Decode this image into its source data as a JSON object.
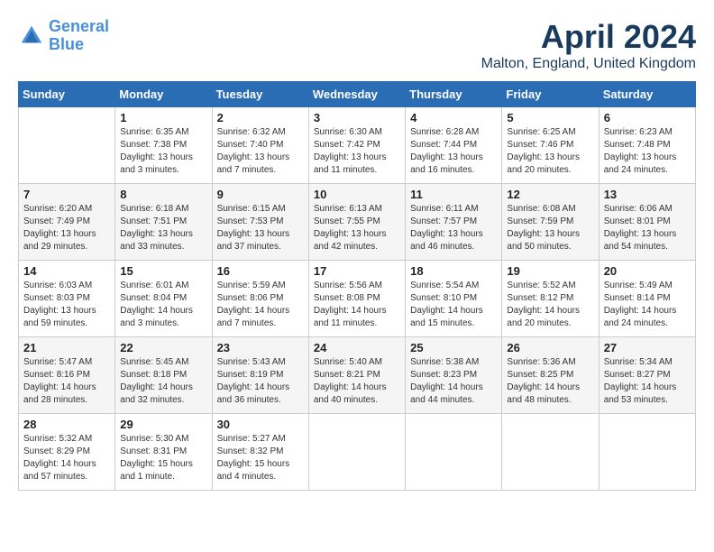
{
  "header": {
    "logo_line1": "General",
    "logo_line2": "Blue",
    "month": "April 2024",
    "location": "Malton, England, United Kingdom"
  },
  "weekdays": [
    "Sunday",
    "Monday",
    "Tuesday",
    "Wednesday",
    "Thursday",
    "Friday",
    "Saturday"
  ],
  "weeks": [
    [
      {
        "day": "",
        "sunrise": "",
        "sunset": "",
        "daylight": ""
      },
      {
        "day": "1",
        "sunrise": "Sunrise: 6:35 AM",
        "sunset": "Sunset: 7:38 PM",
        "daylight": "Daylight: 13 hours and 3 minutes."
      },
      {
        "day": "2",
        "sunrise": "Sunrise: 6:32 AM",
        "sunset": "Sunset: 7:40 PM",
        "daylight": "Daylight: 13 hours and 7 minutes."
      },
      {
        "day": "3",
        "sunrise": "Sunrise: 6:30 AM",
        "sunset": "Sunset: 7:42 PM",
        "daylight": "Daylight: 13 hours and 11 minutes."
      },
      {
        "day": "4",
        "sunrise": "Sunrise: 6:28 AM",
        "sunset": "Sunset: 7:44 PM",
        "daylight": "Daylight: 13 hours and 16 minutes."
      },
      {
        "day": "5",
        "sunrise": "Sunrise: 6:25 AM",
        "sunset": "Sunset: 7:46 PM",
        "daylight": "Daylight: 13 hours and 20 minutes."
      },
      {
        "day": "6",
        "sunrise": "Sunrise: 6:23 AM",
        "sunset": "Sunset: 7:48 PM",
        "daylight": "Daylight: 13 hours and 24 minutes."
      }
    ],
    [
      {
        "day": "7",
        "sunrise": "Sunrise: 6:20 AM",
        "sunset": "Sunset: 7:49 PM",
        "daylight": "Daylight: 13 hours and 29 minutes."
      },
      {
        "day": "8",
        "sunrise": "Sunrise: 6:18 AM",
        "sunset": "Sunset: 7:51 PM",
        "daylight": "Daylight: 13 hours and 33 minutes."
      },
      {
        "day": "9",
        "sunrise": "Sunrise: 6:15 AM",
        "sunset": "Sunset: 7:53 PM",
        "daylight": "Daylight: 13 hours and 37 minutes."
      },
      {
        "day": "10",
        "sunrise": "Sunrise: 6:13 AM",
        "sunset": "Sunset: 7:55 PM",
        "daylight": "Daylight: 13 hours and 42 minutes."
      },
      {
        "day": "11",
        "sunrise": "Sunrise: 6:11 AM",
        "sunset": "Sunset: 7:57 PM",
        "daylight": "Daylight: 13 hours and 46 minutes."
      },
      {
        "day": "12",
        "sunrise": "Sunrise: 6:08 AM",
        "sunset": "Sunset: 7:59 PM",
        "daylight": "Daylight: 13 hours and 50 minutes."
      },
      {
        "day": "13",
        "sunrise": "Sunrise: 6:06 AM",
        "sunset": "Sunset: 8:01 PM",
        "daylight": "Daylight: 13 hours and 54 minutes."
      }
    ],
    [
      {
        "day": "14",
        "sunrise": "Sunrise: 6:03 AM",
        "sunset": "Sunset: 8:03 PM",
        "daylight": "Daylight: 13 hours and 59 minutes."
      },
      {
        "day": "15",
        "sunrise": "Sunrise: 6:01 AM",
        "sunset": "Sunset: 8:04 PM",
        "daylight": "Daylight: 14 hours and 3 minutes."
      },
      {
        "day": "16",
        "sunrise": "Sunrise: 5:59 AM",
        "sunset": "Sunset: 8:06 PM",
        "daylight": "Daylight: 14 hours and 7 minutes."
      },
      {
        "day": "17",
        "sunrise": "Sunrise: 5:56 AM",
        "sunset": "Sunset: 8:08 PM",
        "daylight": "Daylight: 14 hours and 11 minutes."
      },
      {
        "day": "18",
        "sunrise": "Sunrise: 5:54 AM",
        "sunset": "Sunset: 8:10 PM",
        "daylight": "Daylight: 14 hours and 15 minutes."
      },
      {
        "day": "19",
        "sunrise": "Sunrise: 5:52 AM",
        "sunset": "Sunset: 8:12 PM",
        "daylight": "Daylight: 14 hours and 20 minutes."
      },
      {
        "day": "20",
        "sunrise": "Sunrise: 5:49 AM",
        "sunset": "Sunset: 8:14 PM",
        "daylight": "Daylight: 14 hours and 24 minutes."
      }
    ],
    [
      {
        "day": "21",
        "sunrise": "Sunrise: 5:47 AM",
        "sunset": "Sunset: 8:16 PM",
        "daylight": "Daylight: 14 hours and 28 minutes."
      },
      {
        "day": "22",
        "sunrise": "Sunrise: 5:45 AM",
        "sunset": "Sunset: 8:18 PM",
        "daylight": "Daylight: 14 hours and 32 minutes."
      },
      {
        "day": "23",
        "sunrise": "Sunrise: 5:43 AM",
        "sunset": "Sunset: 8:19 PM",
        "daylight": "Daylight: 14 hours and 36 minutes."
      },
      {
        "day": "24",
        "sunrise": "Sunrise: 5:40 AM",
        "sunset": "Sunset: 8:21 PM",
        "daylight": "Daylight: 14 hours and 40 minutes."
      },
      {
        "day": "25",
        "sunrise": "Sunrise: 5:38 AM",
        "sunset": "Sunset: 8:23 PM",
        "daylight": "Daylight: 14 hours and 44 minutes."
      },
      {
        "day": "26",
        "sunrise": "Sunrise: 5:36 AM",
        "sunset": "Sunset: 8:25 PM",
        "daylight": "Daylight: 14 hours and 48 minutes."
      },
      {
        "day": "27",
        "sunrise": "Sunrise: 5:34 AM",
        "sunset": "Sunset: 8:27 PM",
        "daylight": "Daylight: 14 hours and 53 minutes."
      }
    ],
    [
      {
        "day": "28",
        "sunrise": "Sunrise: 5:32 AM",
        "sunset": "Sunset: 8:29 PM",
        "daylight": "Daylight: 14 hours and 57 minutes."
      },
      {
        "day": "29",
        "sunrise": "Sunrise: 5:30 AM",
        "sunset": "Sunset: 8:31 PM",
        "daylight": "Daylight: 15 hours and 1 minute."
      },
      {
        "day": "30",
        "sunrise": "Sunrise: 5:27 AM",
        "sunset": "Sunset: 8:32 PM",
        "daylight": "Daylight: 15 hours and 4 minutes."
      },
      {
        "day": "",
        "sunrise": "",
        "sunset": "",
        "daylight": ""
      },
      {
        "day": "",
        "sunrise": "",
        "sunset": "",
        "daylight": ""
      },
      {
        "day": "",
        "sunrise": "",
        "sunset": "",
        "daylight": ""
      },
      {
        "day": "",
        "sunrise": "",
        "sunset": "",
        "daylight": ""
      }
    ]
  ]
}
